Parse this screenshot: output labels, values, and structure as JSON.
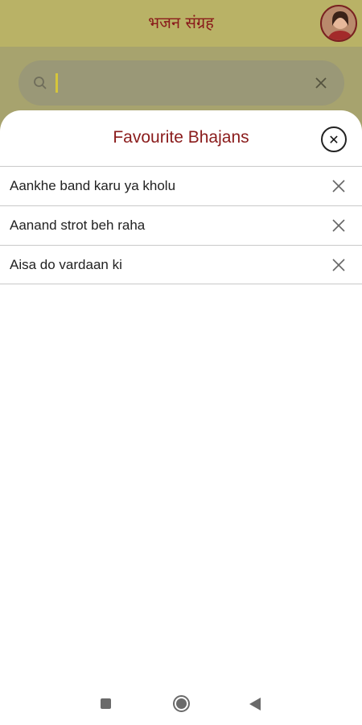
{
  "app": {
    "title": "भजन संग्रह"
  },
  "search": {
    "value": "",
    "placeholder": ""
  },
  "sheet": {
    "title": "Favourite Bhajans",
    "close_icon": "close-circle-icon",
    "items": [
      {
        "label": "Aankhe band karu ya kholu"
      },
      {
        "label": "Aanand strot beh raha"
      },
      {
        "label": "Aisa do vardaan ki"
      }
    ]
  },
  "colors": {
    "accent": "#8a1b1b",
    "header_bg": "#b9b266",
    "overlay_bg": "#a7a36e"
  },
  "navbar": {
    "icons": [
      "recent-apps-icon",
      "home-icon",
      "back-icon"
    ]
  }
}
